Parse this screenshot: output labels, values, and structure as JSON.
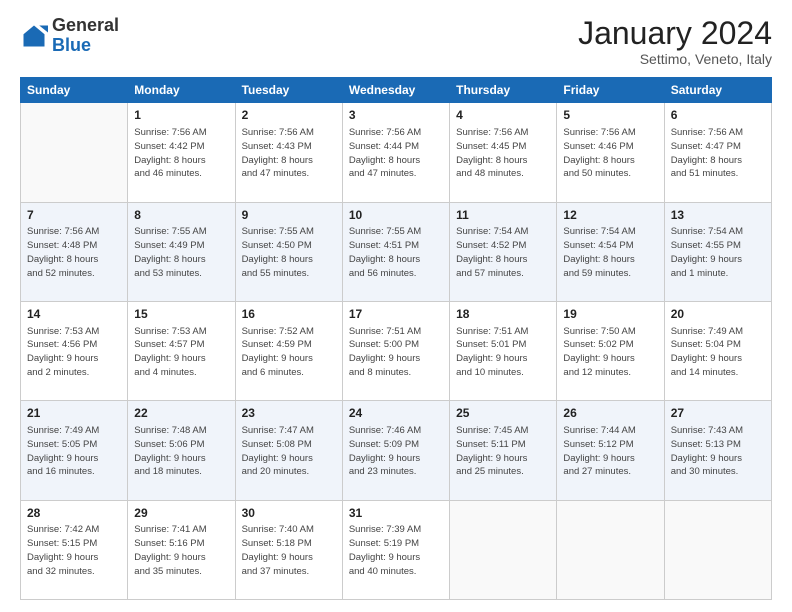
{
  "logo": {
    "general": "General",
    "blue": "Blue"
  },
  "header": {
    "month": "January 2024",
    "location": "Settimo, Veneto, Italy"
  },
  "weekdays": [
    "Sunday",
    "Monday",
    "Tuesday",
    "Wednesday",
    "Thursday",
    "Friday",
    "Saturday"
  ],
  "weeks": [
    [
      {
        "day": "",
        "info": ""
      },
      {
        "day": "1",
        "info": "Sunrise: 7:56 AM\nSunset: 4:42 PM\nDaylight: 8 hours\nand 46 minutes."
      },
      {
        "day": "2",
        "info": "Sunrise: 7:56 AM\nSunset: 4:43 PM\nDaylight: 8 hours\nand 47 minutes."
      },
      {
        "day": "3",
        "info": "Sunrise: 7:56 AM\nSunset: 4:44 PM\nDaylight: 8 hours\nand 47 minutes."
      },
      {
        "day": "4",
        "info": "Sunrise: 7:56 AM\nSunset: 4:45 PM\nDaylight: 8 hours\nand 48 minutes."
      },
      {
        "day": "5",
        "info": "Sunrise: 7:56 AM\nSunset: 4:46 PM\nDaylight: 8 hours\nand 50 minutes."
      },
      {
        "day": "6",
        "info": "Sunrise: 7:56 AM\nSunset: 4:47 PM\nDaylight: 8 hours\nand 51 minutes."
      }
    ],
    [
      {
        "day": "7",
        "info": "Sunrise: 7:56 AM\nSunset: 4:48 PM\nDaylight: 8 hours\nand 52 minutes."
      },
      {
        "day": "8",
        "info": "Sunrise: 7:55 AM\nSunset: 4:49 PM\nDaylight: 8 hours\nand 53 minutes."
      },
      {
        "day": "9",
        "info": "Sunrise: 7:55 AM\nSunset: 4:50 PM\nDaylight: 8 hours\nand 55 minutes."
      },
      {
        "day": "10",
        "info": "Sunrise: 7:55 AM\nSunset: 4:51 PM\nDaylight: 8 hours\nand 56 minutes."
      },
      {
        "day": "11",
        "info": "Sunrise: 7:54 AM\nSunset: 4:52 PM\nDaylight: 8 hours\nand 57 minutes."
      },
      {
        "day": "12",
        "info": "Sunrise: 7:54 AM\nSunset: 4:54 PM\nDaylight: 8 hours\nand 59 minutes."
      },
      {
        "day": "13",
        "info": "Sunrise: 7:54 AM\nSunset: 4:55 PM\nDaylight: 9 hours\nand 1 minute."
      }
    ],
    [
      {
        "day": "14",
        "info": "Sunrise: 7:53 AM\nSunset: 4:56 PM\nDaylight: 9 hours\nand 2 minutes."
      },
      {
        "day": "15",
        "info": "Sunrise: 7:53 AM\nSunset: 4:57 PM\nDaylight: 9 hours\nand 4 minutes."
      },
      {
        "day": "16",
        "info": "Sunrise: 7:52 AM\nSunset: 4:59 PM\nDaylight: 9 hours\nand 6 minutes."
      },
      {
        "day": "17",
        "info": "Sunrise: 7:51 AM\nSunset: 5:00 PM\nDaylight: 9 hours\nand 8 minutes."
      },
      {
        "day": "18",
        "info": "Sunrise: 7:51 AM\nSunset: 5:01 PM\nDaylight: 9 hours\nand 10 minutes."
      },
      {
        "day": "19",
        "info": "Sunrise: 7:50 AM\nSunset: 5:02 PM\nDaylight: 9 hours\nand 12 minutes."
      },
      {
        "day": "20",
        "info": "Sunrise: 7:49 AM\nSunset: 5:04 PM\nDaylight: 9 hours\nand 14 minutes."
      }
    ],
    [
      {
        "day": "21",
        "info": "Sunrise: 7:49 AM\nSunset: 5:05 PM\nDaylight: 9 hours\nand 16 minutes."
      },
      {
        "day": "22",
        "info": "Sunrise: 7:48 AM\nSunset: 5:06 PM\nDaylight: 9 hours\nand 18 minutes."
      },
      {
        "day": "23",
        "info": "Sunrise: 7:47 AM\nSunset: 5:08 PM\nDaylight: 9 hours\nand 20 minutes."
      },
      {
        "day": "24",
        "info": "Sunrise: 7:46 AM\nSunset: 5:09 PM\nDaylight: 9 hours\nand 23 minutes."
      },
      {
        "day": "25",
        "info": "Sunrise: 7:45 AM\nSunset: 5:11 PM\nDaylight: 9 hours\nand 25 minutes."
      },
      {
        "day": "26",
        "info": "Sunrise: 7:44 AM\nSunset: 5:12 PM\nDaylight: 9 hours\nand 27 minutes."
      },
      {
        "day": "27",
        "info": "Sunrise: 7:43 AM\nSunset: 5:13 PM\nDaylight: 9 hours\nand 30 minutes."
      }
    ],
    [
      {
        "day": "28",
        "info": "Sunrise: 7:42 AM\nSunset: 5:15 PM\nDaylight: 9 hours\nand 32 minutes."
      },
      {
        "day": "29",
        "info": "Sunrise: 7:41 AM\nSunset: 5:16 PM\nDaylight: 9 hours\nand 35 minutes."
      },
      {
        "day": "30",
        "info": "Sunrise: 7:40 AM\nSunset: 5:18 PM\nDaylight: 9 hours\nand 37 minutes."
      },
      {
        "day": "31",
        "info": "Sunrise: 7:39 AM\nSunset: 5:19 PM\nDaylight: 9 hours\nand 40 minutes."
      },
      {
        "day": "",
        "info": ""
      },
      {
        "day": "",
        "info": ""
      },
      {
        "day": "",
        "info": ""
      }
    ]
  ]
}
